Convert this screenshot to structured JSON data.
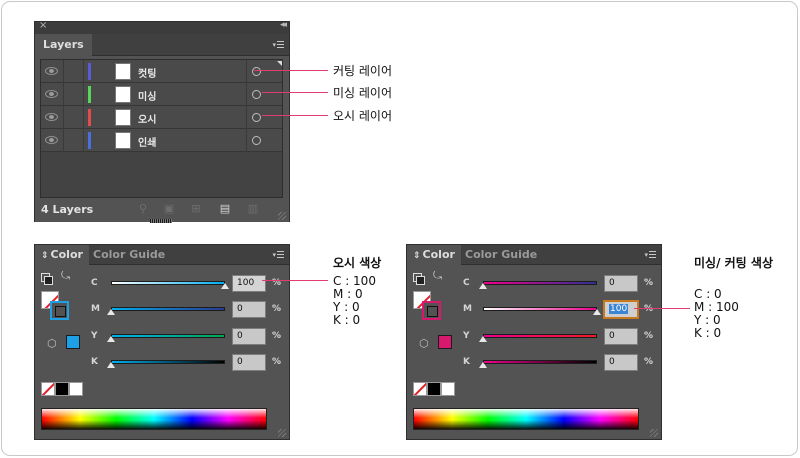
{
  "layers_panel": {
    "tab": "Layers",
    "count_label": "4 Layers",
    "layers": [
      {
        "name": "컷팅",
        "color": "#5b5bd6"
      },
      {
        "name": "미싱",
        "color": "#59d659"
      },
      {
        "name": "오시",
        "color": "#e04d4d"
      },
      {
        "name": "인쇄",
        "color": "#4c6fe0"
      }
    ]
  },
  "callouts": {
    "layer_cutting": "커팅 레이어",
    "layer_missing": "미싱 레이어",
    "layer_osi": "오시 레이어",
    "osi_title": "오시 색상",
    "osi_c": "C : 100",
    "osi_m": "M : 0",
    "osi_y": "Y : 0",
    "osi_k": "K : 0",
    "missing_title": "미싱/ 커팅 색상",
    "missing_c": "C : 0",
    "missing_m": "M : 100",
    "missing_y": "Y : 0",
    "missing_k": "K : 0"
  },
  "color_panel_left": {
    "tabs": [
      "Color",
      "Color Guide"
    ],
    "active_tab": "Color",
    "swatch_color": "#1ea0e6",
    "channels": [
      {
        "label": "C",
        "value": "100",
        "pct": "%"
      },
      {
        "label": "M",
        "value": "0",
        "pct": "%"
      },
      {
        "label": "Y",
        "value": "0",
        "pct": "%"
      },
      {
        "label": "K",
        "value": "0",
        "pct": "%"
      }
    ]
  },
  "color_panel_right": {
    "tabs": [
      "Color",
      "Color Guide"
    ],
    "active_tab": "Color",
    "swatch_color": "#d8186e",
    "channels": [
      {
        "label": "C",
        "value": "0",
        "pct": "%"
      },
      {
        "label": "M",
        "value": "100",
        "pct": "%"
      },
      {
        "label": "Y",
        "value": "0",
        "pct": "%"
      },
      {
        "label": "K",
        "value": "0",
        "pct": "%"
      }
    ]
  }
}
